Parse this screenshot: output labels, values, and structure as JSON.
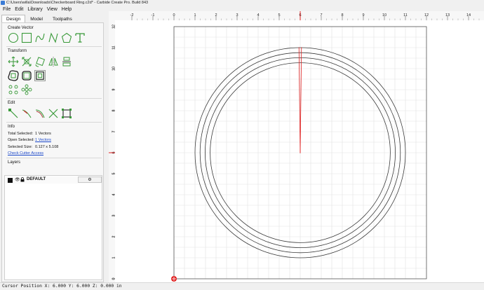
{
  "window": {
    "title": "C:\\Users\\willa\\Downloads\\Checkerboard Ring.c2d* - Carbide Create Pro. Build 843"
  },
  "menu": [
    "File",
    "Edit",
    "Library",
    "View",
    "Help"
  ],
  "tabs": [
    "Design",
    "Model",
    "Toolpaths"
  ],
  "sections": {
    "create_vector": "Create Vector",
    "transform": "Transform",
    "edit": "Edit",
    "info": "Info",
    "layers": "Layers"
  },
  "info": {
    "total_selected_label": "Total Selected:",
    "total_selected_value": "1 Vectors",
    "open_selected_label": "Open Selected:",
    "open_selected_value": "1 Vectors",
    "selected_size_label": "Selected Size:",
    "selected_size_value": "0.127 x 5.108",
    "check_cutter_access": "Check Cutter Access"
  },
  "layers": [
    {
      "name": "DEFAULT",
      "color": "#111111",
      "visible": true,
      "locked": true
    }
  ],
  "add_layer_label": "+",
  "layer_settings_icon": "gear-icon",
  "status": {
    "cursor": "Cursor Position X: 6.000 Y: 6.000 Z: 0.000 in"
  },
  "ruler": {
    "x_ticks": [
      "-2",
      "-1",
      "0",
      "1",
      "2",
      "3",
      "4",
      "5",
      "6",
      "7",
      "8",
      "9",
      "10",
      "11",
      "12",
      "13",
      "14"
    ],
    "y_ticks": [
      "12",
      "11",
      "10",
      "9",
      "8",
      "7",
      "6",
      "5",
      "4",
      "3",
      "2",
      "1",
      "0"
    ],
    "cursor_x": 6,
    "cursor_y": 6
  },
  "colors": {
    "accent_green": "#3a9a3a",
    "cursor_red": "#e02020",
    "link_blue": "#1a47c9"
  }
}
